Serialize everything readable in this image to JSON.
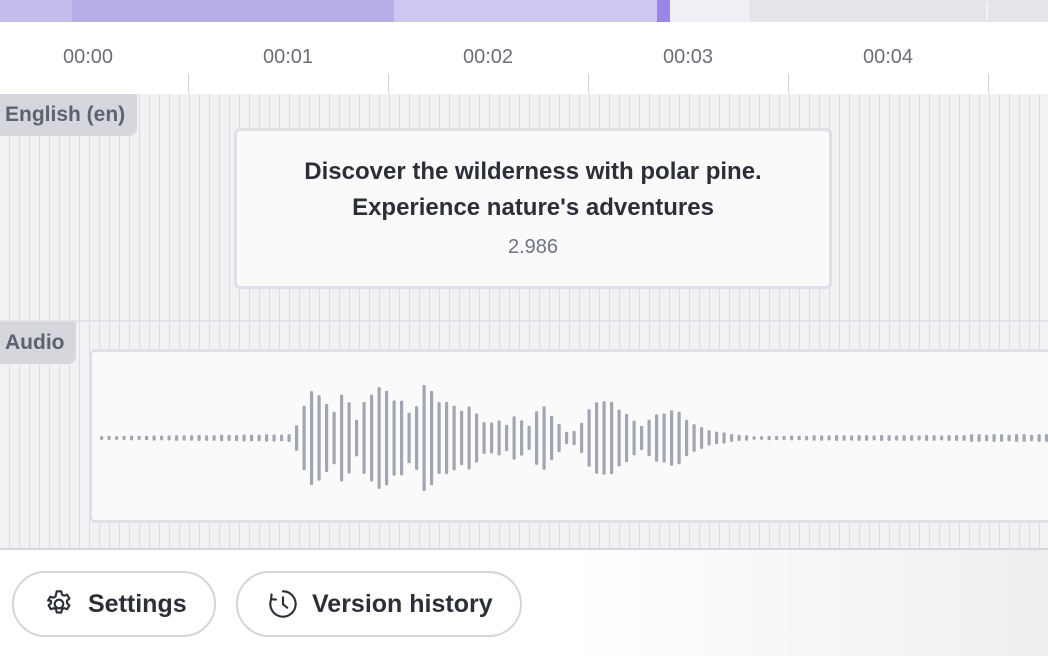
{
  "timeline": {
    "labels": [
      "00:00",
      "00:01",
      "00:02",
      "00:03",
      "00:04"
    ]
  },
  "tracks": {
    "subtitle_label": "English (en)",
    "audio_label": "Audio"
  },
  "caption": {
    "line1": "Discover the wilderness with polar pine.",
    "line2": "Experience nature's adventures",
    "duration": "2.986"
  },
  "footer": {
    "settings_label": "Settings",
    "history_label": "Version history"
  },
  "icons": {
    "settings": "gear-icon",
    "history": "clock-history-icon"
  },
  "colors": {
    "accent": "#9b85e6",
    "waveform": "#a2a6b2"
  }
}
